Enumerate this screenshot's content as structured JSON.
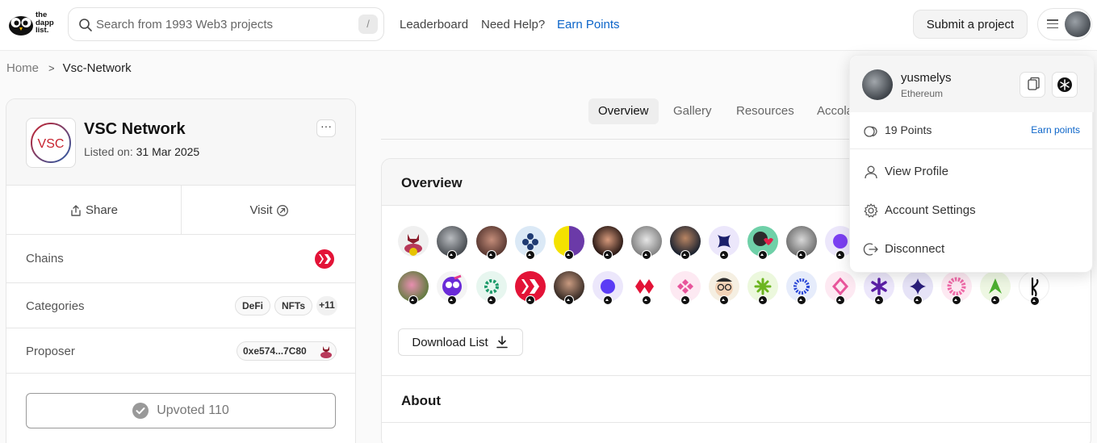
{
  "header": {
    "logo_lines": [
      "the",
      "dapp",
      "list."
    ],
    "search": {
      "placeholder": "Search from 1993 Web3 projects",
      "shortcut": "/"
    },
    "nav": {
      "leaderboard": "Leaderboard",
      "need_help": "Need Help?",
      "earn_points": "Earn Points"
    },
    "submit_label": "Submit a project"
  },
  "breadcrumb": {
    "home": "Home",
    "separator": ">",
    "current": "Vsc-Network"
  },
  "project": {
    "logo_text": "VSC",
    "name": "VSC Network",
    "listed_label": "Listed on:",
    "listed_date": "31 Mar 2025",
    "more_label": "···",
    "share_label": "Share",
    "visit_label": "Visit",
    "chains_label": "Chains",
    "categories_label": "Categories",
    "categories": [
      "DeFi",
      "NFTs",
      "+11"
    ],
    "proposer_label": "Proposer",
    "proposer_address": "0xe574...7C80",
    "upvote_label": "Upvoted 110"
  },
  "tabs": [
    "Overview",
    "Gallery",
    "Resources",
    "Accolades"
  ],
  "overview": {
    "title": "Overview",
    "download_label": "Download List",
    "about_title": "About"
  },
  "dropdown": {
    "username": "yusmelys",
    "chain": "Ethereum",
    "points": "19 Points",
    "earn_points": "Earn points",
    "items": [
      "View Profile",
      "Account Settings",
      "Disconnect"
    ]
  },
  "colors": {
    "accent": "#0c65c9",
    "hive_red": "#e31337"
  }
}
